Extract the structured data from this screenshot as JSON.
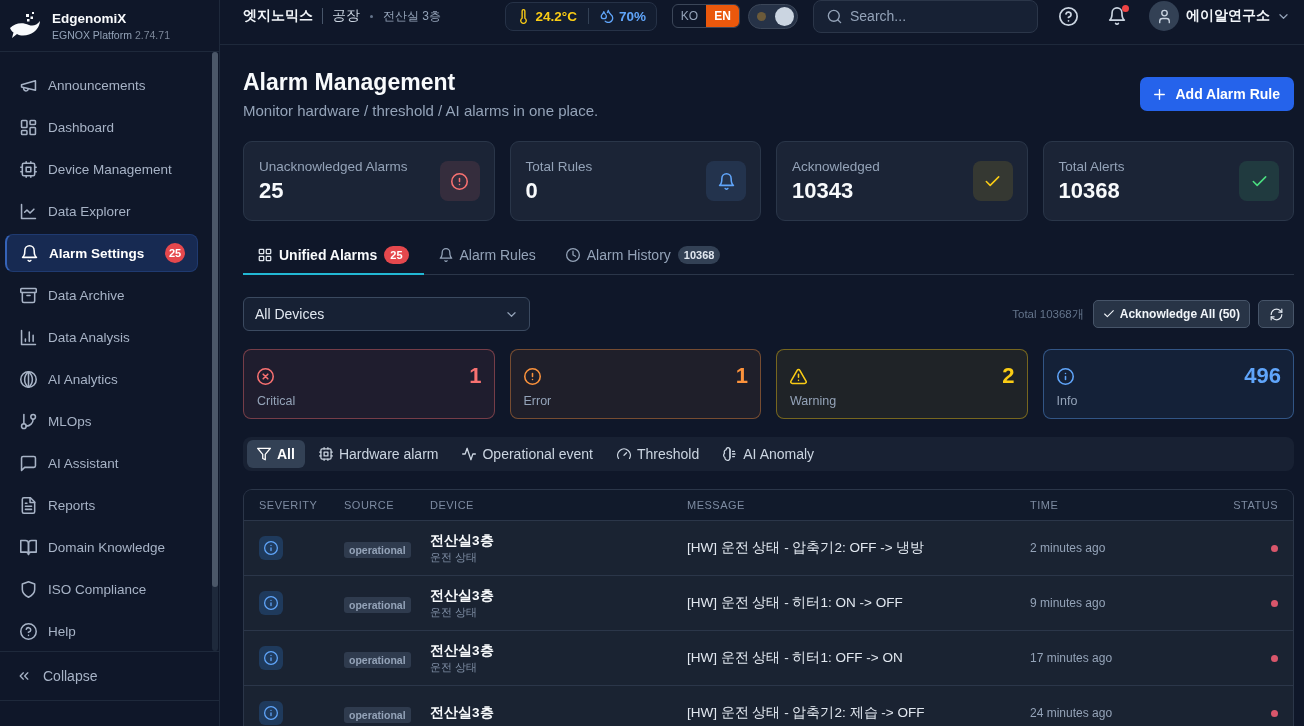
{
  "sidebar": {
    "brand": "EdgenomiX",
    "platform": "EGNOX Platform",
    "version": "2.74.71",
    "items": [
      {
        "label": "Announcements",
        "selected": false
      },
      {
        "label": "Dashboard",
        "selected": false
      },
      {
        "label": "Device Management",
        "selected": false
      },
      {
        "label": "Data Explorer",
        "selected": false
      },
      {
        "label": "Alarm Settings",
        "selected": true,
        "badge": "25"
      },
      {
        "label": "Data Archive",
        "selected": false
      },
      {
        "label": "Data Analysis",
        "selected": false
      },
      {
        "label": "AI Analytics",
        "selected": false
      },
      {
        "label": "MLOps",
        "selected": false
      },
      {
        "label": "AI Assistant",
        "selected": false
      },
      {
        "label": "Reports",
        "selected": false
      },
      {
        "label": "Domain Knowledge",
        "selected": false
      },
      {
        "label": "ISO Compliance",
        "selected": false
      },
      {
        "label": "Help",
        "selected": false
      }
    ],
    "collapse": "Collapse"
  },
  "topbar": {
    "breadcrumb": [
      "엣지노믹스",
      "공장",
      "전산실 3층"
    ],
    "weather": {
      "temperature": "24.2°C",
      "humidity": "70%"
    },
    "languages": [
      {
        "label": "KO",
        "selected": false
      },
      {
        "label": "EN",
        "selected": true
      }
    ],
    "theme_toggle": {
      "on": true
    },
    "search": {
      "placeholder": "Search..."
    },
    "notifications": {
      "unread": true
    },
    "user": {
      "name": "에이알연구소"
    }
  },
  "page": {
    "title": "Alarm Management",
    "subtitle": "Monitor hardware / threshold / AI alarms in one place.",
    "add_button": "Add Alarm Rule"
  },
  "stats": [
    {
      "label": "Unacknowledged Alarms",
      "value": "25",
      "color": "#f87171"
    },
    {
      "label": "Total Rules",
      "value": "0",
      "color": "#60a5fa"
    },
    {
      "label": "Acknowledged",
      "value": "10343",
      "color": "#facc15"
    },
    {
      "label": "Total Alerts",
      "value": "10368",
      "color": "#4ade80"
    }
  ],
  "tabs": [
    {
      "label": "Unified Alarms",
      "selected": true,
      "badge": {
        "text": "25",
        "kind": "alert"
      }
    },
    {
      "label": "Alarm Rules",
      "selected": false
    },
    {
      "label": "Alarm History",
      "selected": false,
      "badge": {
        "text": "10368",
        "kind": "count"
      }
    }
  ],
  "toolbar": {
    "device_filter": "All Devices",
    "total": "Total 10368개",
    "acknowledge_all": "Acknowledge All (50)"
  },
  "severity_summary": [
    {
      "label": "Critical",
      "count": "1",
      "color": "#f87171"
    },
    {
      "label": "Error",
      "count": "1",
      "color": "#fb923c"
    },
    {
      "label": "Warning",
      "count": "2",
      "color": "#facc15"
    },
    {
      "label": "Info",
      "count": "496",
      "color": "#60a5fa"
    }
  ],
  "categories": [
    {
      "label": "All",
      "selected": true
    },
    {
      "label": "Hardware alarm",
      "selected": false
    },
    {
      "label": "Operational event",
      "selected": false
    },
    {
      "label": "Threshold",
      "selected": false
    },
    {
      "label": "AI Anomaly",
      "selected": false
    }
  ],
  "table": {
    "columns": [
      "SEVERITY",
      "SOURCE",
      "DEVICE",
      "MESSAGE",
      "TIME",
      "STATUS"
    ],
    "rows": [
      {
        "kind": "info",
        "source": "operational",
        "device": "전산실3층",
        "detail": "운전 상태",
        "message": "[HW] 운전 상태 - 압축기2: OFF -> 냉방",
        "time": "2 minutes ago",
        "acknowledged": false
      },
      {
        "kind": "info",
        "source": "operational",
        "device": "전산실3층",
        "detail": "운전 상태",
        "message": "[HW] 운전 상태 - 히터1: ON -> OFF",
        "time": "9 minutes ago",
        "acknowledged": false
      },
      {
        "kind": "info",
        "source": "operational",
        "device": "전산실3층",
        "detail": "운전 상태",
        "message": "[HW] 운전 상태 - 히터1: OFF -> ON",
        "time": "17 minutes ago",
        "acknowledged": false
      },
      {
        "kind": "info",
        "source": "operational",
        "device": "전산실3층",
        "message": "[HW] 운전 상태 - 압축기2: 제습 -> OFF",
        "time": "24 minutes ago",
        "acknowledged": false
      }
    ]
  }
}
